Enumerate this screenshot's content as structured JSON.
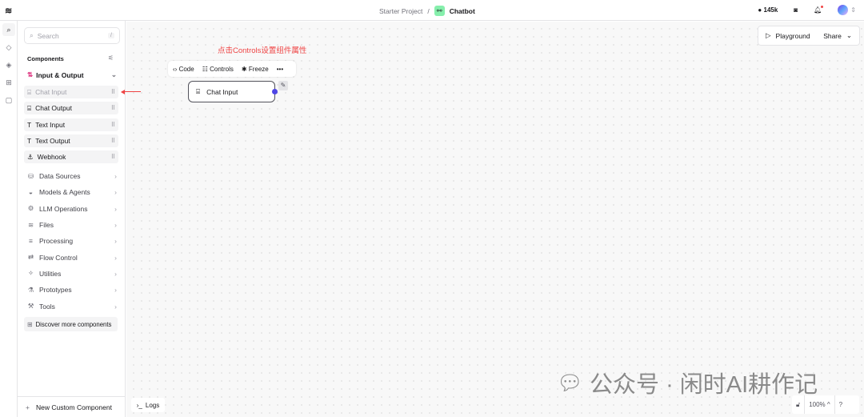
{
  "header": {
    "project": "Starter Project",
    "separator": "/",
    "flow_name": "Chatbot",
    "github_stars": "145k"
  },
  "search": {
    "placeholder": "Search",
    "shortcut": "/"
  },
  "sidebar": {
    "components_label": "Components",
    "category_open": "Input & Output",
    "io_items": [
      {
        "label": "Chat Input",
        "icon": "chat-icon"
      },
      {
        "label": "Chat Output",
        "icon": "chat-icon"
      },
      {
        "label": "Text Input",
        "icon": "text-icon"
      },
      {
        "label": "Text Output",
        "icon": "text-icon"
      },
      {
        "label": "Webhook",
        "icon": "webhook-icon"
      }
    ],
    "categories": [
      {
        "label": "Data Sources",
        "icon": "⛁"
      },
      {
        "label": "Models & Agents",
        "icon": "◒"
      },
      {
        "label": "LLM Operations",
        "icon": "⚙"
      },
      {
        "label": "Files",
        "icon": "≋"
      },
      {
        "label": "Processing",
        "icon": "≡"
      },
      {
        "label": "Flow Control",
        "icon": "⇄"
      },
      {
        "label": "Utilities",
        "icon": "✧"
      },
      {
        "label": "Prototypes",
        "icon": "⚗"
      },
      {
        "label": "Tools",
        "icon": "⚒"
      }
    ],
    "discover": "Discover more components",
    "new_custom": "New Custom Component"
  },
  "canvas": {
    "playground": "Playground",
    "share": "Share",
    "annotation": "点击Controls设置组件属性",
    "toolbar": {
      "code": "Code",
      "controls": "Controls",
      "freeze": "Freeze",
      "more": "•••"
    },
    "node_label": "Chat Input",
    "logs": "Logs",
    "zoom": "100%",
    "watermark": "公众号 · 闲时AI耕作记"
  }
}
